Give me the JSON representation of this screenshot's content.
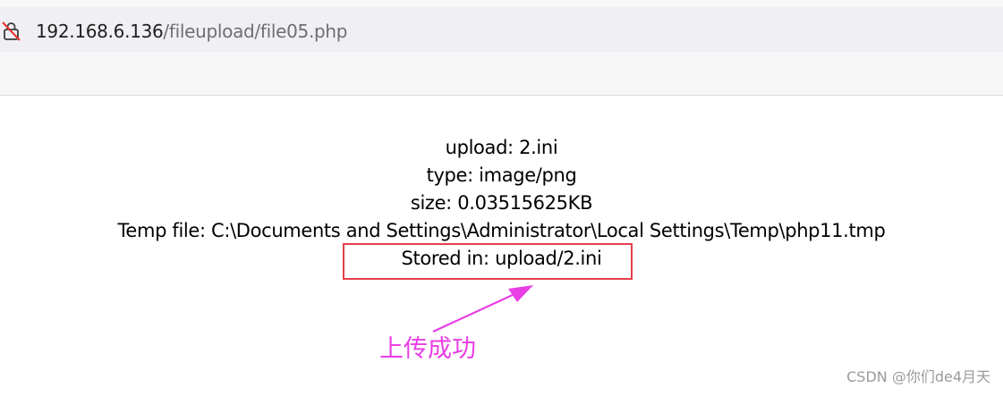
{
  "browser": {
    "url_host": "192.168.6.136",
    "url_path": "/fileupload/file05.php",
    "security_icon": "insecure-lock-icon"
  },
  "page": {
    "lines": [
      "upload: 2.ini",
      "type: image/png",
      "size: 0.03515625KB",
      "Temp file: C:\\Documents and Settings\\Administrator\\Local Settings\\Temp\\php11.tmp",
      "Stored in: upload/2.ini"
    ]
  },
  "annotation": {
    "text": "上传成功",
    "color": "#e93ee6",
    "box_color": "#e53f4b"
  },
  "watermark": {
    "text": "CSDN @你们de4月天"
  }
}
